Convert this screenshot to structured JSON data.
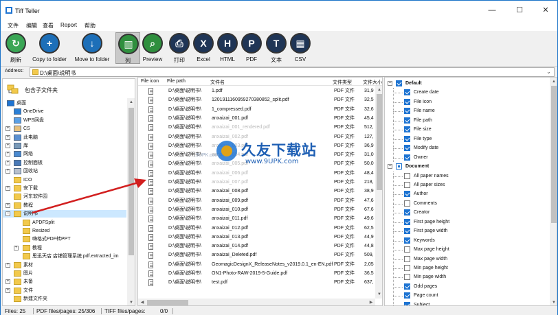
{
  "window": {
    "title": "Tiff Teller"
  },
  "menu": [
    "文件",
    "编辑",
    "查看",
    "Report",
    "帮助"
  ],
  "toolbar": [
    {
      "label": "刷新",
      "icon": "refresh-icon",
      "color": "#3aa655"
    },
    {
      "label": "Copy to folder",
      "icon": "copy-to-folder-icon",
      "color": "#1d6fb8"
    },
    {
      "label": "Move to folder",
      "icon": "move-to-folder-icon",
      "color": "#1d6fb8"
    },
    {
      "label": "列",
      "icon": "columns-icon",
      "color": "#2f8f3e"
    },
    {
      "label": "Preview",
      "icon": "preview-icon",
      "color": "#2f8f3e"
    },
    {
      "label": "打印",
      "icon": "print-icon",
      "color": "#1f3556"
    },
    {
      "label": "Excel",
      "icon": "excel-icon",
      "color": "#1f3556"
    },
    {
      "label": "HTML",
      "icon": "html-icon",
      "color": "#1f3556"
    },
    {
      "label": "PDF",
      "icon": "pdf-icon",
      "color": "#1f3556"
    },
    {
      "label": "文本",
      "icon": "text-icon",
      "color": "#1f3556"
    },
    {
      "label": "CSV",
      "icon": "csv-icon",
      "color": "#1f3556"
    }
  ],
  "address": {
    "label": "Address:",
    "value": "D:\\桌面\\说明书"
  },
  "tree": {
    "include_subfolders": "包含子文件夹",
    "items": [
      {
        "label": "桌面",
        "level": 0,
        "exp": "",
        "icon": "desktop"
      },
      {
        "label": "OneDrive",
        "level": 1,
        "exp": "",
        "icon": "cloud"
      },
      {
        "label": "WPS网盘",
        "level": 1,
        "exp": "",
        "icon": "cloud2"
      },
      {
        "label": "CS",
        "level": 1,
        "exp": "+",
        "icon": "user"
      },
      {
        "label": "此电脑",
        "level": 1,
        "exp": "+",
        "icon": "pc"
      },
      {
        "label": "库",
        "level": 1,
        "exp": "+",
        "icon": "lib"
      },
      {
        "label": "网络",
        "level": 1,
        "exp": "+",
        "icon": "net"
      },
      {
        "label": "控制面板",
        "level": 1,
        "exp": "+",
        "icon": "cpanel"
      },
      {
        "label": "回收站",
        "level": 1,
        "exp": "+",
        "icon": "bin"
      },
      {
        "label": "ICO",
        "level": 1,
        "exp": "",
        "icon": "folder"
      },
      {
        "label": "安下载",
        "level": 1,
        "exp": "+",
        "icon": "folder"
      },
      {
        "label": "河东软件园",
        "level": 1,
        "exp": "",
        "icon": "folder"
      },
      {
        "label": "教程",
        "level": 1,
        "exp": "+",
        "icon": "folder"
      },
      {
        "label": "说明书",
        "level": 1,
        "exp": "-",
        "icon": "folder",
        "selected": true
      },
      {
        "label": "APDFSplit",
        "level": 2,
        "exp": "",
        "icon": "folder"
      },
      {
        "label": "Resized",
        "level": 2,
        "exp": "",
        "icon": "folder"
      },
      {
        "label": "嗨格式PDF转PPT",
        "level": 2,
        "exp": "",
        "icon": "folder"
      },
      {
        "label": "教程",
        "level": 2,
        "exp": "+",
        "icon": "folder"
      },
      {
        "label": "思迅天店 店铺管理系统.pdf.extracted_im",
        "level": 2,
        "exp": "",
        "icon": "folder"
      },
      {
        "label": "素材",
        "level": 1,
        "exp": "+",
        "icon": "folder"
      },
      {
        "label": "图片",
        "level": 1,
        "exp": "",
        "icon": "folder"
      },
      {
        "label": "未备",
        "level": 1,
        "exp": "+",
        "icon": "folder"
      },
      {
        "label": "文件",
        "level": 1,
        "exp": "+",
        "icon": "folder"
      },
      {
        "label": "新建文件夹",
        "level": 1,
        "exp": "",
        "icon": "folder"
      }
    ]
  },
  "files": {
    "columns": [
      "File icon",
      "File path",
      "文件名",
      "文件类型",
      "文件大小"
    ],
    "rows": [
      {
        "path": "D:\\桌面\\说明书\\",
        "name": "1.pdf",
        "type": "PDF 文件",
        "size": "31,9"
      },
      {
        "path": "D:\\桌面\\说明书\\",
        "name": "120191116095927038085​2_split.pdf",
        "type": "PDF 文件",
        "size": "32,5"
      },
      {
        "path": "D:\\桌面\\说明书\\",
        "name": "1_compressed.pdf",
        "type": "PDF 文件",
        "size": "32,6"
      },
      {
        "path": "D:\\桌面\\说明书\\",
        "name": "anxaizai_001.pdf",
        "type": "PDF 文件",
        "size": "45,4"
      },
      {
        "path": "D:\\桌面\\说明书\\",
        "name": "anxaizai_001_rendered.pdf",
        "type": "PDF 文件",
        "size": "512,",
        "faded": true
      },
      {
        "path": "D:\\桌面\\说明书\\",
        "name": "anxaizai_002.pdf",
        "type": "PDF 文件",
        "size": "127,",
        "faded": true
      },
      {
        "path": "D:\\桌面\\说明书\\",
        "name": "anxaizai_003.pdf",
        "type": "PDF 文件",
        "size": "36,9",
        "faded": true
      },
      {
        "path": "D:\\桌面\\说明书\\",
        "name": "anxaizai_004.pdf",
        "type": "PDF 文件",
        "size": "31,0",
        "faded": true
      },
      {
        "path": "D:\\桌面\\说明书\\",
        "name": "anxaizai_005.pdf",
        "type": "PDF 文件",
        "size": "50,0",
        "faded": true
      },
      {
        "path": "D:\\桌面\\说明书\\",
        "name": "anxaizai_006.pdf",
        "type": "PDF 文件",
        "size": "48,4",
        "faded": true
      },
      {
        "path": "D:\\桌面\\说明书\\",
        "name": "anxaizai_007.pdf",
        "type": "PDF 文件",
        "size": "218,",
        "faded": true
      },
      {
        "path": "D:\\桌面\\说明书\\",
        "name": "anxaizai_008.pdf",
        "type": "PDF 文件",
        "size": "38,9"
      },
      {
        "path": "D:\\桌面\\说明书\\",
        "name": "anxaizai_009.pdf",
        "type": "PDF 文件",
        "size": "47,6"
      },
      {
        "path": "D:\\桌面\\说明书\\",
        "name": "anxaizai_010.pdf",
        "type": "PDF 文件",
        "size": "67,6"
      },
      {
        "path": "D:\\桌面\\说明书\\",
        "name": "anxaizai_011.pdf",
        "type": "PDF 文件",
        "size": "49,6"
      },
      {
        "path": "D:\\桌面\\说明书\\",
        "name": "anxaizai_012.pdf",
        "type": "PDF 文件",
        "size": "62,5"
      },
      {
        "path": "D:\\桌面\\说明书\\",
        "name": "anxaizai_013.pdf",
        "type": "PDF 文件",
        "size": "44,9"
      },
      {
        "path": "D:\\桌面\\说明书\\",
        "name": "anxaizai_014.pdf",
        "type": "PDF 文件",
        "size": "44,8"
      },
      {
        "path": "D:\\桌面\\说明书\\",
        "name": "anxaizai_Deleted.pdf",
        "type": "PDF 文件",
        "size": "509,"
      },
      {
        "path": "D:\\桌面\\说明书\\",
        "name": "GeomagicDesignX_ReleaseNotes_v2019.0.1_en-EN.pdf",
        "type": "PDF 文件",
        "size": "2,05"
      },
      {
        "path": "D:\\桌面\\说明书\\",
        "name": "ON1-Photo-RAW-2019-5-Guide.pdf",
        "type": "PDF 文件",
        "size": "36,5"
      },
      {
        "path": "D:\\桌面\\说明书\\",
        "name": "test.pdf",
        "type": "PDF 文件",
        "size": "637,"
      }
    ]
  },
  "props": [
    {
      "label": "Default",
      "group": true,
      "checked": true
    },
    {
      "label": "Create date",
      "checked": true
    },
    {
      "label": "File icon",
      "checked": true
    },
    {
      "label": "File name",
      "checked": true
    },
    {
      "label": "File path",
      "checked": true
    },
    {
      "label": "File size",
      "checked": true
    },
    {
      "label": "File type",
      "checked": true
    },
    {
      "label": "Modify date",
      "checked": true
    },
    {
      "label": "Owner",
      "checked": true
    },
    {
      "label": "Document",
      "group": true,
      "partial": true
    },
    {
      "label": "All paper names",
      "checked": false
    },
    {
      "label": "All paper sizes",
      "checked": false
    },
    {
      "label": "Author",
      "checked": true
    },
    {
      "label": "Comments",
      "checked": false
    },
    {
      "label": "Creator",
      "checked": true
    },
    {
      "label": "First page height",
      "checked": true
    },
    {
      "label": "First page width",
      "checked": true
    },
    {
      "label": "Keywords",
      "checked": true
    },
    {
      "label": "Max page height",
      "checked": false
    },
    {
      "label": "Max page width",
      "checked": false
    },
    {
      "label": "Min page height",
      "checked": false
    },
    {
      "label": "Min page width",
      "checked": false
    },
    {
      "label": "Odd pages",
      "checked": true
    },
    {
      "label": "Page count",
      "checked": true
    },
    {
      "label": "Subject",
      "checked": true
    }
  ],
  "status": {
    "files": "Files: 25",
    "pdf": "PDF files/pages: 25/306",
    "tiff": "TIFF files/pages:",
    "tiff_count": "0/0"
  },
  "watermark": {
    "brand": "久友下载站",
    "url": "www.9UPK.com",
    "url_small": ".9UPK.com"
  },
  "colors": {
    "accent": "#1e74d2",
    "selection": "#cce8ff",
    "arrow": "#d21f1f"
  }
}
